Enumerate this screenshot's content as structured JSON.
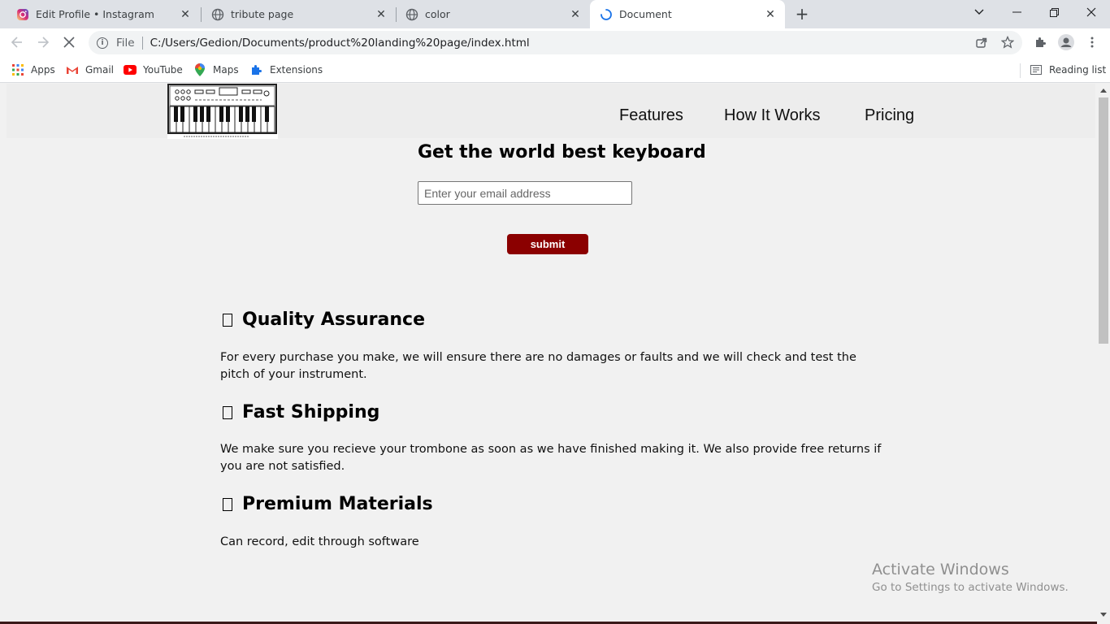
{
  "browser": {
    "tabs": [
      {
        "title": "Edit Profile • Instagram",
        "icon": "instagram-icon"
      },
      {
        "title": "tribute page",
        "icon": "globe-icon"
      },
      {
        "title": "color",
        "icon": "globe-icon"
      },
      {
        "title": "Document",
        "icon": "loading-spinner-icon",
        "active": true
      }
    ],
    "address": {
      "scheme": "File",
      "url": "C:/Users/Gedion/Documents/product%20landing%20page/index.html"
    },
    "bookmarks": [
      {
        "label": "Apps",
        "icon": "apps-grid-icon"
      },
      {
        "label": "Gmail",
        "icon": "gmail-icon"
      },
      {
        "label": "YouTube",
        "icon": "youtube-icon"
      },
      {
        "label": "Maps",
        "icon": "maps-pin-icon"
      },
      {
        "label": "Extensions",
        "icon": "puzzle-icon"
      }
    ],
    "reading_list": "Reading list"
  },
  "page": {
    "nav": [
      "Features",
      "How It Works",
      "Pricing"
    ],
    "hero": {
      "title": "Get the world best keyboard",
      "email_placeholder": "Enter your email address",
      "submit": "submit"
    },
    "features": [
      {
        "title": "Quality Assurance",
        "text": "For every purchase you make, we will ensure there are no damages or faults and we will check and test the pitch of your instrument."
      },
      {
        "title": "Fast Shipping",
        "text": "We make sure you recieve your trombone as soon as we have finished making it. We also provide free returns if you are not satisfied."
      },
      {
        "title": "Premium Materials",
        "text": "Can record, edit through software"
      }
    ]
  },
  "watermark": {
    "line1": "Activate Windows",
    "line2": "Go to Settings to activate Windows."
  },
  "colors": {
    "submit_bg": "#8b0000",
    "page_bg": "#f1f1f1",
    "header_bg": "#ededed"
  }
}
